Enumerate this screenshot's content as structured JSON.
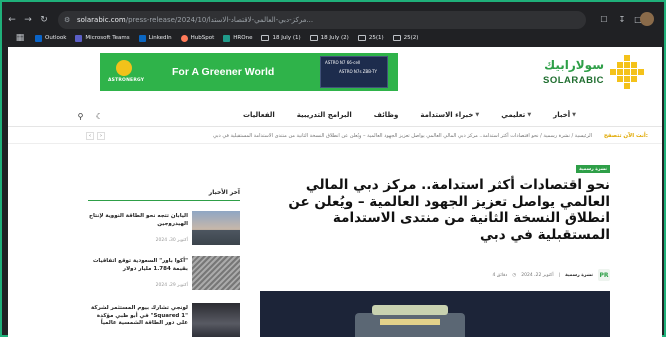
{
  "browser": {
    "url_host": "solarabic.com",
    "url_path": "/press-release/2024/10/مركز-دبي-العالمي-لاقتصاد-الاستدا...",
    "icons": [
      "back-icon",
      "forward-icon",
      "reload-icon",
      "site-info-icon",
      "extensions-icon",
      "download-icon",
      "sidebar-icon"
    ]
  },
  "bookmarks": [
    {
      "label": "Outlook",
      "color": "#0a64c8"
    },
    {
      "label": "Microsoft Teams",
      "color": "#5b5fc7"
    },
    {
      "label": "LinkedIn",
      "color": "#0a66c2"
    },
    {
      "label": "HubSpot",
      "color": "#ff7a59"
    },
    {
      "label": "HROne",
      "color": "#1f9a8a"
    },
    {
      "label": "18 July (1)",
      "folder": true
    },
    {
      "label": "18 July (2)",
      "folder": true
    },
    {
      "label": "25(1)",
      "folder": true
    },
    {
      "label": "25(2)",
      "folder": true
    }
  ],
  "ad": {
    "logo_text": "ASTRONERGY",
    "headline": "For A Greener World",
    "panel_text_1": "ASTRO N7 66-cell",
    "panel_text_2": "ASTRO N7s ZBB-TY"
  },
  "brand": {
    "arabic": "سولارابيك",
    "english": "SOLARABIC",
    "accent": "#2e9f48"
  },
  "menu": [
    {
      "label": "أخبار",
      "has_dropdown": true
    },
    {
      "label": "تعليمي",
      "has_dropdown": true
    },
    {
      "label": "خبراء الاستدامة",
      "has_dropdown": true
    },
    {
      "label": "وظائف",
      "has_dropdown": false
    },
    {
      "label": "البرامج التدريبية",
      "has_dropdown": false
    },
    {
      "label": "الفعاليات",
      "has_dropdown": false
    }
  ],
  "ticker": {
    "label": "أنت الآن تتصفح:",
    "crumbs": "الرئيسية  /  نشرة رسمية  /  نحو اقتصادات أكثر استدامة.. مركز دبي المالي العالمي يواصل تعزيز الجهود العالمية – ويُعلن عن انطلاق النسخة الثانية من منتدى الاستدامة المستقبلية في دبي",
    "home": "الرئيسية"
  },
  "article": {
    "category": "نشرة رسمية",
    "title": "نحو اقتصادات أكثر استدامة.. مركز دبي المالي العالمي يواصل تعزيز الجهود العالمية – ويُعلن عن انطلاق النسخة الثانية من منتدى الاستدامة المستقبلية في دبي",
    "author_badge": "PR",
    "author": "نشرة رسمية",
    "date": "أكتوبر 22، 2024",
    "read_time": "4 دقائق"
  },
  "sidebar": {
    "heading": "آخر الأخبار",
    "items": [
      {
        "title": "اليابان تتجه نحو الطاقة النووية لإنتاج الهيدروجين",
        "date": "أكتوبر 30، 2024"
      },
      {
        "title": "\"أكوا باور\" السعودية توقع اتفاقيات بقيمة 1.784 مليار دولار",
        "date": "أكتوبر 29، 2024"
      },
      {
        "title": "لونجي تشارك بيوم المستثمر لشركة \"Squared 1\" في أبو ظبي مؤكدة على دور الطاقة الشمسية عالمياً",
        "date": ""
      }
    ]
  }
}
